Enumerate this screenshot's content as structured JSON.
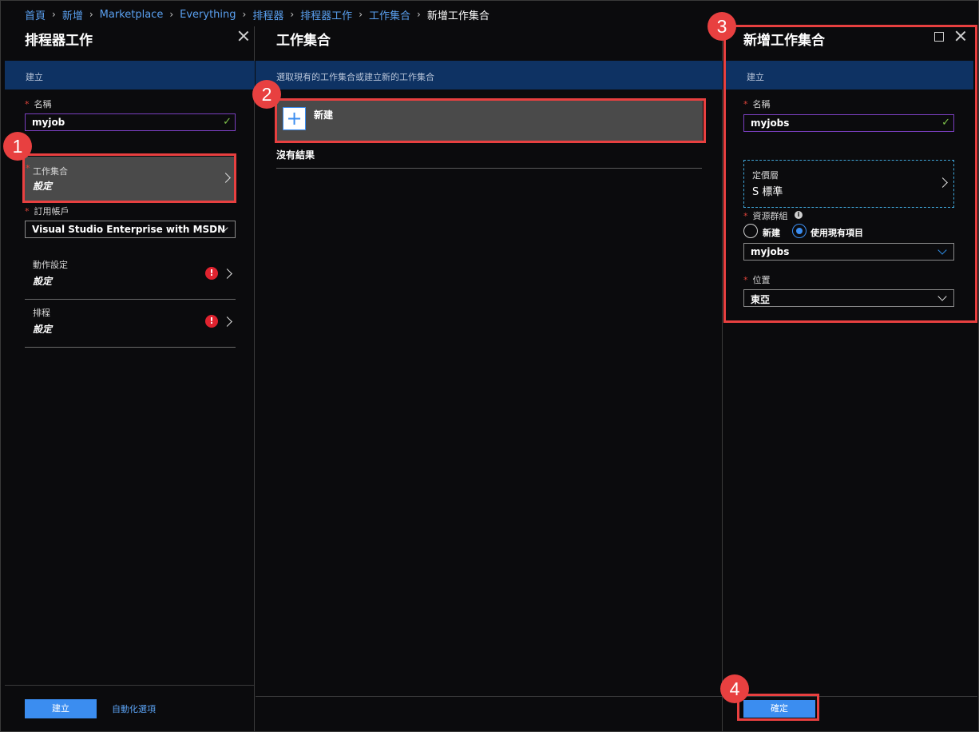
{
  "breadcrumb": {
    "items": [
      "首頁",
      "新增",
      "Marketplace",
      "Everything",
      "排程器",
      "排程器工作",
      "工作集合"
    ],
    "current": "新增工作集合"
  },
  "blade1": {
    "title": "排程器工作",
    "bar_text": "建立",
    "name_label": "名稱",
    "name_value": "myjob",
    "collection_label": "工作集合",
    "collection_value": "設定",
    "subscription_label": "訂用帳戶",
    "subscription_value": "Visual Studio Enterprise with MSDN",
    "action_label": "動作設定",
    "action_value": "設定",
    "schedule_label": "排程",
    "schedule_value": "設定",
    "create_button": "建立",
    "automation_link": "自動化選項"
  },
  "blade2": {
    "title": "工作集合",
    "bar_text": "選取現有的工作集合或建立新的工作集合",
    "new_item_label": "新建",
    "no_results": "沒有結果"
  },
  "blade3": {
    "title": "新增工作集合",
    "bar_text": "建立",
    "name_label": "名稱",
    "name_value": "myjobs",
    "pricing_label": "定價層",
    "pricing_value": "S 標準",
    "rg_label": "資源群組",
    "rg_new_label": "新建",
    "rg_existing_label": "使用現有項目",
    "rg_value": "myjobs",
    "location_label": "位置",
    "location_value": "東亞",
    "ok_button": "確定"
  },
  "annotations": [
    "1",
    "2",
    "3",
    "4"
  ],
  "icons": {
    "error": "!",
    "check": "✓",
    "plus": "+",
    "info": "i"
  },
  "colors": {
    "accent": "#3b8df0",
    "annotation": "#e84040",
    "bar": "#0e3263",
    "error": "#e0232f",
    "check": "#7ec24a"
  }
}
